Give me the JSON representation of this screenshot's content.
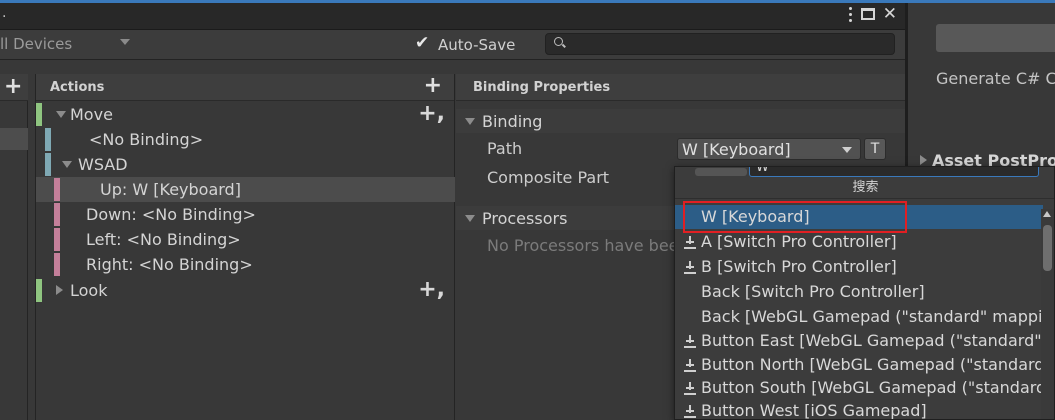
{
  "window": {
    "title_fragment": ".",
    "menu_icon": "kebab-menu-icon",
    "maximize_icon": "maximize-icon",
    "close_label": "✕"
  },
  "toolbar": {
    "devices_label": "ll Devices",
    "autosave_checked": true,
    "autosave_label": "Auto-Save",
    "search_placeholder": ""
  },
  "actions_panel": {
    "title": "Actions",
    "add_label": "+",
    "items": [
      {
        "label": "Move",
        "kind": "action",
        "expanded": true,
        "color": "#8fc580"
      },
      {
        "label": "<No Binding>",
        "kind": "binding",
        "color": "#7fa9b4"
      },
      {
        "label": "WSAD",
        "kind": "composite",
        "expanded": true,
        "color": "#7fa9b4"
      },
      {
        "label": "Up: W [Keyboard]",
        "kind": "part",
        "selected": true,
        "color": "#c47f9a"
      },
      {
        "label": "Down: <No Binding>",
        "kind": "part",
        "color": "#c47f9a"
      },
      {
        "label": "Left: <No Binding>",
        "kind": "part",
        "color": "#c47f9a"
      },
      {
        "label": "Right: <No Binding>",
        "kind": "part",
        "color": "#c47f9a"
      },
      {
        "label": "Look",
        "kind": "action",
        "expanded": false,
        "color": "#8fc580"
      }
    ],
    "row_add_label": "+,"
  },
  "binding_properties": {
    "title": "Binding Properties",
    "binding_section": "Binding",
    "path_label": "Path",
    "path_value": "W [Keyboard]",
    "t_button": "T",
    "composite_part_label": "Composite Part",
    "processors_section": "Processors",
    "no_processors_text": "No Processors have been added."
  },
  "right_panel": {
    "generate_label": "Generate C# C",
    "asset_postprocessor_label": "Asset PostPro"
  },
  "popup": {
    "search_value": "W",
    "title": "搜索",
    "items": [
      {
        "label": "W [Keyboard]",
        "icon": false,
        "highlight": true
      },
      {
        "label": "A [Switch Pro Controller]",
        "icon": true
      },
      {
        "label": "B [Switch Pro Controller]",
        "icon": true
      },
      {
        "label": "Back [Switch Pro Controller]",
        "icon": false
      },
      {
        "label": "Back [WebGL Gamepad (\"standard\" mapping)]",
        "icon": false
      },
      {
        "label": "Button East [WebGL Gamepad (\"standard\" mapping)]",
        "icon": true
      },
      {
        "label": "Button North [WebGL Gamepad (\"standard\" mapping)]",
        "icon": true
      },
      {
        "label": "Button South [WebGL Gamepad (\"standard\" mapping)]",
        "icon": true
      },
      {
        "label": "Button West [iOS Gamepad]",
        "icon": true
      }
    ]
  },
  "colors": {
    "accent": "#3a79bb",
    "highlight": "#2c5d87",
    "annotation_red": "#e11f23"
  }
}
